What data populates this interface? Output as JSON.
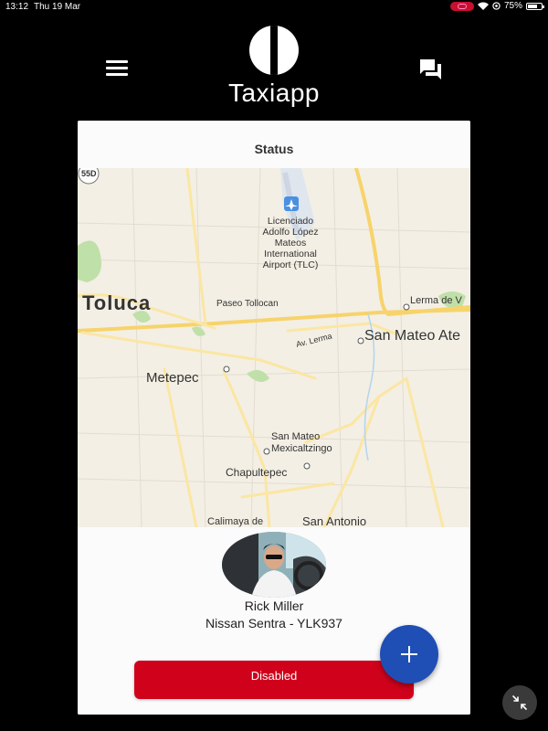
{
  "status_bar": {
    "time": "13:12",
    "date": "Thu 19 Mar",
    "battery": "75%"
  },
  "header": {
    "app_title": "Taxiapp",
    "menu_icon": "hamburger-menu-icon",
    "chat_icon": "question-answer-icon"
  },
  "card": {
    "title": "Status"
  },
  "map": {
    "highway_shield": "55D",
    "airport_label": [
      "Licenciado",
      "Adolfo López",
      "Mateos",
      "International",
      "Airport (TLC)"
    ],
    "labels": {
      "toluca": "Toluca",
      "paseo": "Paseo Tollocan",
      "lerma": "Lerma de V",
      "san_mateo_ate": "San Mateo Ate",
      "av_lerma": "Av. Lerma",
      "metepec": "Metepec",
      "san_mateo_mex_1": "San Mateo",
      "san_mateo_mex_2": "Mexicaltzingo",
      "chapultepec": "Chapultepec",
      "calimaya": "Calimaya de",
      "san_antonio": "San Antonio"
    }
  },
  "driver": {
    "name": "Rick Miller",
    "vehicle": "Nissan Sentra - YLK937"
  },
  "actions": {
    "status_button": "Disabled",
    "fab_icon": "plus-icon",
    "shrink_icon": "minimize-arrows-icon"
  },
  "colors": {
    "status_button": "#d0021b",
    "fab": "#1f4eb5",
    "background": "#000000"
  }
}
